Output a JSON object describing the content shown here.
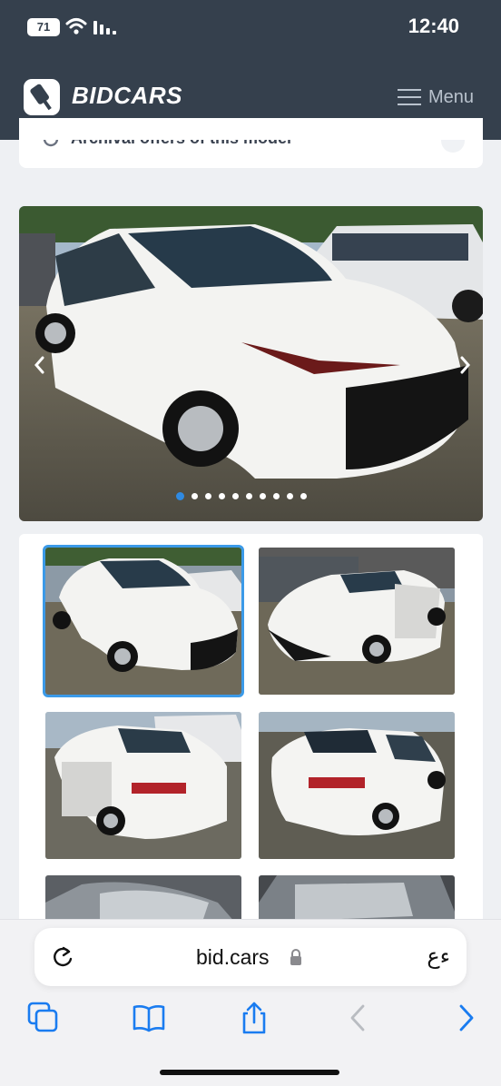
{
  "status_bar": {
    "battery_level": "71",
    "time": "12:40"
  },
  "header": {
    "brand": "BIDCARS",
    "menu_label": "Menu"
  },
  "archival": {
    "label": "Archival offers of this model"
  },
  "gallery": {
    "dot_count": 10,
    "active_dot": 0,
    "thumbnail_count": 6,
    "selected_thumbnail": 0
  },
  "browser": {
    "url": "bid.cars",
    "reader_label": "ءع"
  },
  "colors": {
    "header_bg": "#35404d",
    "accent": "#2f8ae2",
    "safari_blue": "#1a7cf0"
  }
}
